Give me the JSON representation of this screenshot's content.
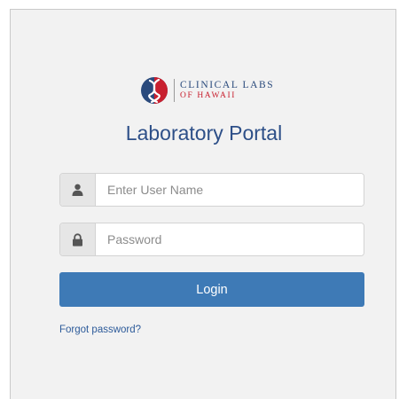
{
  "logo": {
    "line1": "CLINICAL LABS",
    "line2": "OF HAWAII",
    "icon": "clinical-labs-dna-logo-icon"
  },
  "page": {
    "title": "Laboratory Portal"
  },
  "form": {
    "username": {
      "value": "",
      "placeholder": "Enter User Name",
      "icon": "user-icon"
    },
    "password": {
      "value": "",
      "placeholder": "Password",
      "icon": "lock-icon"
    },
    "login_label": "Login",
    "forgot_label": "Forgot password?"
  },
  "colors": {
    "title": "#2d4f88",
    "button": "#3e7ab6",
    "link": "#2d5b9a",
    "logo_blue": "#2a4a7c",
    "logo_red": "#c8202f",
    "panel": "#f2f2f2"
  }
}
